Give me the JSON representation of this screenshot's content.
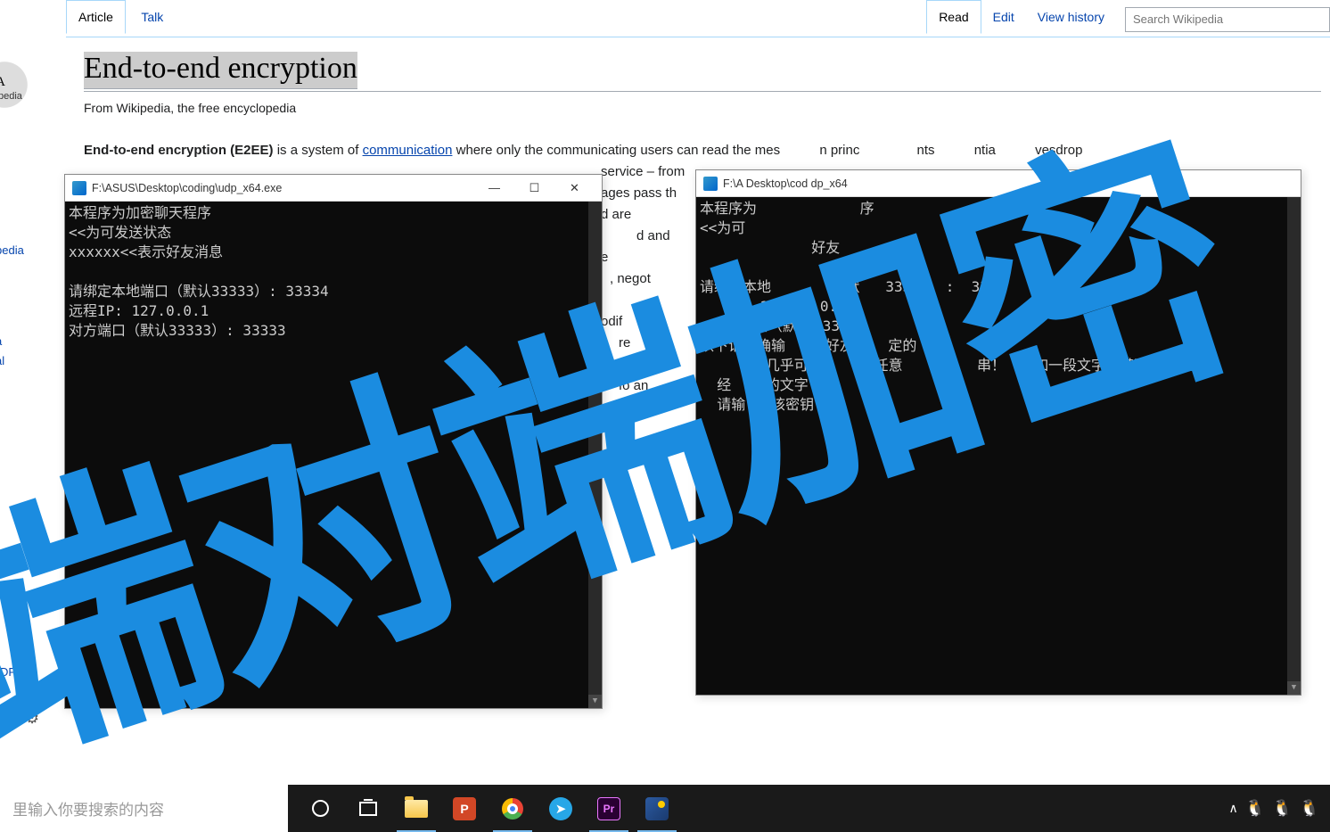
{
  "wiki": {
    "logo_text": "ɪA",
    "logo_sub": "pedia",
    "sidebar_links": [
      "pedia",
      "",
      "a",
      "al"
    ],
    "pdf_link1": "DF",
    "pdf_link2": "ɴ",
    "tabs_left": {
      "article": "Article",
      "talk": "Talk"
    },
    "tabs_right": {
      "read": "Read",
      "edit": "Edit",
      "history": "View history"
    },
    "search_placeholder": "Search Wikipedia",
    "title": "End-to-end encryption",
    "subtitle": "From Wikipedia, the free encyclopedia",
    "body_bold": "End-to-end encryption",
    "body_paren": "(E2EE)",
    "body_rest1": " is a system of ",
    "body_link": "communication",
    "body_rest2": " where only the communicating users can read the mes",
    "body_rest3": "n princ",
    "body_rest4": "nts",
    "body_rest5": "ntia",
    "body_rest6": "vesdrop",
    "line2a": "service – from",
    "line3a": "ages pass th",
    "line4a": "d are ",
    "line5a": "d and",
    "line6a": "e",
    "line7a": ", negot",
    "line8a": "odif",
    "line9a": "re",
    "line10a": "fo    an"
  },
  "term1": {
    "title": "F:\\ASUS\\Desktop\\coding\\udp_x64.exe",
    "lines": [
      "本程序为加密聊天程序",
      "<<为可发送状态",
      "xxxxxx<<表示好友消息",
      "",
      "请绑定本地端口（默认33333）: 33334",
      "远程IP: 127.0.0.1",
      "对方端口（默认33333）: 33333"
    ]
  },
  "term2": {
    "title": "F:\\A        Desktop\\cod        dp_x64",
    "lines": [
      "本程序为            序",
      "<<为可",
      "             好友",
      "",
      "请绑定本地       （默   333    :  333",
      "   IP: 12     0.1",
      "   方端口（默   33333      33",
      "以下请正确输   与好友    定的",
      "      明几乎可      是任意    的   串！（例如一段文字，甚至可以是一",
      "  经    的文字",
      "  请输   该密钥"
    ]
  },
  "overlay": "端对端加密",
  "taskbar": {
    "search": "里输入你要搜索的内容",
    "icons": [
      "cortana",
      "taskview",
      "folder",
      "powerpoint",
      "chrome",
      "telegram",
      "premiere",
      "custom"
    ]
  }
}
